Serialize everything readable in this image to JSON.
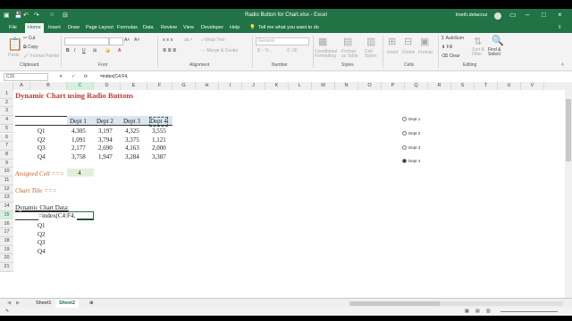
{
  "window": {
    "title": "Radio Button for Chart.xlsx  -  Excel",
    "user": "lineth.delacruz"
  },
  "tabs": [
    "File",
    "Home",
    "Insert",
    "Draw",
    "Page Layout",
    "Formulas",
    "Data",
    "Review",
    "View",
    "Developer",
    "Help"
  ],
  "active_tab": "Home",
  "tell_me": "Tell me what you want to do",
  "ribbon": {
    "clipboard": {
      "paste": "Paste",
      "cut": "Cut",
      "copy": "Copy",
      "format_painter": "Format Painter",
      "group": "Clipboard"
    },
    "font": {
      "group": "Font",
      "bold": "B",
      "italic": "I",
      "underline": "U"
    },
    "alignment": {
      "wrap": "Wrap Text",
      "merge": "Merge & Center",
      "group": "Alignment"
    },
    "number": {
      "format": "General",
      "group": "Number"
    },
    "styles": {
      "conditional": "Conditional Formatting",
      "format_table": "Format as Table",
      "cell_styles": "Cell Styles",
      "group": "Styles"
    },
    "cells": {
      "insert": "Insert",
      "delete": "Delete",
      "format": "Format",
      "group": "Cells"
    },
    "editing": {
      "autosum": "AutoSum",
      "fill": "Fill",
      "clear": "Clear",
      "sort": "Sort & Filter",
      "find": "Find & Select",
      "group": "Editing"
    }
  },
  "formula_bar": {
    "name_box": "C15",
    "fx": "fx",
    "formula": "=index(C4:F4,"
  },
  "columns": [
    "A",
    "B",
    "C",
    "D",
    "E",
    "F",
    "G",
    "H",
    "I",
    "J",
    "K",
    "L",
    "M",
    "N",
    "O",
    "P",
    "Q",
    "R",
    "S",
    "T",
    "U",
    "V"
  ],
  "rows": [
    "1",
    "2",
    "3",
    "4",
    "5",
    "6",
    "7",
    "8",
    "9",
    "10",
    "11",
    "12",
    "13",
    "14",
    "15",
    "16",
    "17",
    "18",
    "19",
    "20",
    "21"
  ],
  "sheet": {
    "title": "Dynamic Chart using Radio Buttons",
    "headers": [
      "Dept 1",
      "Dept 2",
      "Dept 3",
      "Dept 4"
    ],
    "data_rows": [
      {
        "label": "Q1",
        "values": [
          "4,305",
          "3,197",
          "4,325",
          "3,555"
        ]
      },
      {
        "label": "Q2",
        "values": [
          "1,091",
          "3,794",
          "3,375",
          "1,121"
        ]
      },
      {
        "label": "Q3",
        "values": [
          "2,177",
          "2,690",
          "4,163",
          "2,000"
        ]
      },
      {
        "label": "Q4",
        "values": [
          "3,758",
          "1,947",
          "3,284",
          "3,387"
        ]
      }
    ],
    "assigned_label": "Assigned Cell ==>",
    "assigned_value": "4",
    "chart_title_label": "Chart Title ==>",
    "dynamic_label": "Dynamic Chart Data:",
    "editing_formula": "=index(C4:F4,",
    "quarters": [
      "Q1",
      "Q2",
      "Q3",
      "Q4"
    ]
  },
  "radios": [
    {
      "label": "Dept 1",
      "checked": false
    },
    {
      "label": "Dept 2",
      "checked": false
    },
    {
      "label": "Dept 3",
      "checked": false
    },
    {
      "label": "Dept 4",
      "checked": true
    }
  ],
  "sheet_tabs": [
    "Sheet1",
    "Sheet2"
  ],
  "active_sheet": "Sheet2",
  "colors": {
    "excel_green": "#217346",
    "title_red": "#c0392b",
    "label_orange": "#c0622b",
    "assigned_fill": "#e2efda",
    "header_fill": "#dce6f1"
  }
}
